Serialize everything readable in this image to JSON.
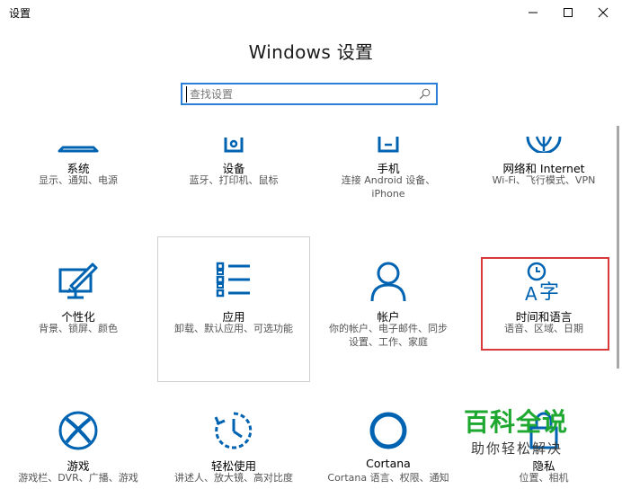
{
  "window": {
    "title": "设置",
    "controls": {
      "minimize": "minimize-icon",
      "maximize": "maximize-icon",
      "close": "close-icon"
    }
  },
  "page_title": "Windows 设置",
  "search": {
    "placeholder": "查找设置",
    "value": ""
  },
  "colors": {
    "accent": "#0063b1",
    "search_border": "#2b7fd6",
    "highlight": "#d9393a",
    "watermark_green": "#1ea830"
  },
  "tiles": [
    {
      "name": "系统",
      "desc": [
        "显示、通知、电源"
      ],
      "icon": "laptop-icon"
    },
    {
      "name": "设备",
      "desc": [
        "蓝牙、打印机、鼠标"
      ],
      "icon": "devices-icon"
    },
    {
      "name": "手机",
      "desc": [
        "连接 Android 设备、",
        "iPhone"
      ],
      "icon": "phone-icon"
    },
    {
      "name": "网络和 Internet",
      "desc": [
        "Wi-Fi、飞行模式、VPN"
      ],
      "icon": "globe-icon"
    },
    {
      "name": "个性化",
      "desc": [
        "背景、锁屏、颜色"
      ],
      "icon": "personalization-icon"
    },
    {
      "name": "应用",
      "desc": [
        "卸载、默认应用、可选功能"
      ],
      "icon": "apps-icon"
    },
    {
      "name": "帐户",
      "desc": [
        "你的帐户、电子邮件、同步",
        "设置、工作、家庭"
      ],
      "icon": "account-icon"
    },
    {
      "name": "时间和语言",
      "desc": [
        "语音、区域、日期"
      ],
      "icon": "time-language-icon"
    },
    {
      "name": "游戏",
      "desc": [
        "游戏栏、DVR、广播、游戏"
      ],
      "icon": "xbox-icon"
    },
    {
      "name": "轻松使用",
      "desc": [
        "讲述人、放大镜、高对比度"
      ],
      "icon": "ease-of-access-icon"
    },
    {
      "name": "Cortana",
      "desc": [
        "Cortana 语言、权限、通知"
      ],
      "icon": "cortana-icon"
    },
    {
      "name": "隐私",
      "desc": [
        "位置、相机"
      ],
      "icon": "lock-icon"
    }
  ],
  "watermark": {
    "big": "百科全说",
    "small": "助你轻松解决"
  }
}
